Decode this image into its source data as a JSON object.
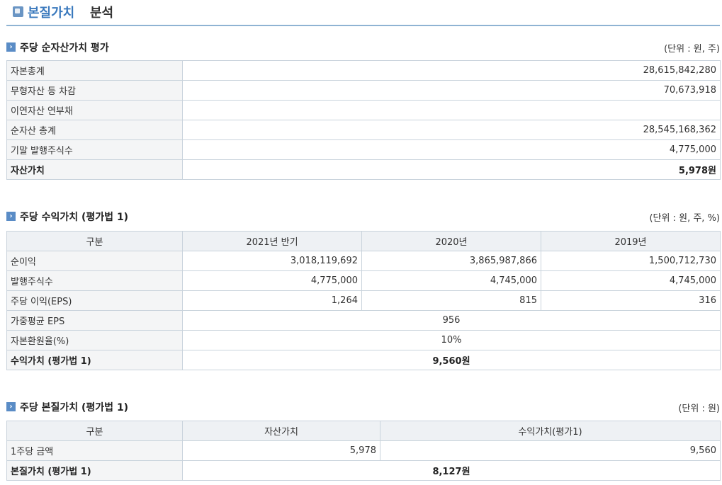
{
  "page": {
    "title_highlight": "본질가치",
    "title_rest": "분석"
  },
  "colors": {
    "accent": "#3a79bd",
    "header_bg": "#eef1f4",
    "label_bg": "#f4f5f6",
    "border": "#c9d3dc"
  },
  "net_asset": {
    "title": "주당 순자산가치 평가",
    "unit": "(단위 : 원, 주)",
    "rows": [
      {
        "label": "자본총계",
        "value": "28,615,842,280"
      },
      {
        "label": "무형자산 등 차감",
        "value": "70,673,918"
      },
      {
        "label": "이연자산 연부채",
        "value": ""
      },
      {
        "label": "순자산 총계",
        "value": "28,545,168,362"
      },
      {
        "label": "기말 발행주식수",
        "value": "4,775,000"
      }
    ],
    "total": {
      "label": "자산가치",
      "value": "5,978원"
    }
  },
  "earnings": {
    "title": "주당 수익가치 (평가법 1)",
    "unit": "(단위 : 원, 주, %)",
    "headers": [
      "구분",
      "2021년 반기",
      "2020년",
      "2019년"
    ],
    "rows": [
      {
        "label": "순이익",
        "values": [
          "3,018,119,692",
          "3,865,987,866",
          "1,500,712,730"
        ]
      },
      {
        "label": "발행주식수",
        "values": [
          "4,775,000",
          "4,745,000",
          "4,745,000"
        ]
      },
      {
        "label": "주당 이익(EPS)",
        "values": [
          "1,264",
          "815",
          "316"
        ]
      }
    ],
    "weighted_eps": {
      "label": "가중평균 EPS",
      "value": "956"
    },
    "cap_rate": {
      "label": "자본환원율(%)",
      "value": "10%"
    },
    "total": {
      "label": "수익가치 (평가법 1)",
      "value": "9,560원"
    }
  },
  "intrinsic": {
    "title": "주당 본질가치 (평가법 1)",
    "unit": "(단위 : 원)",
    "headers": [
      "구분",
      "자산가치",
      "수익가치(평가1)"
    ],
    "row": {
      "label": "1주당 금액",
      "asset": "5,978",
      "earning": "9,560"
    },
    "total": {
      "label": "본질가치 (평가법 1)",
      "value": "8,127원"
    }
  }
}
